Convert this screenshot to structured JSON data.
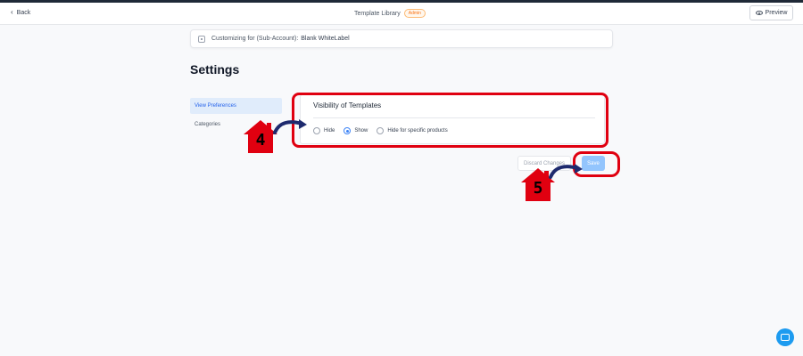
{
  "header": {
    "back_label": "Back",
    "title": "Template Library",
    "badge": "Admin",
    "preview_label": "Preview"
  },
  "customizing": {
    "label": "Customizing for (Sub-Account):",
    "value": "Blank WhiteLabel"
  },
  "page": {
    "title": "Settings"
  },
  "sidebar": {
    "items": [
      {
        "label": "View Preferences",
        "active": true
      },
      {
        "label": "Categories",
        "active": false
      }
    ]
  },
  "visibility": {
    "title": "Visibility of Templates",
    "options": [
      {
        "label": "Hide",
        "selected": false
      },
      {
        "label": "Show",
        "selected": true
      },
      {
        "label": "Hide for specific products",
        "selected": false
      }
    ]
  },
  "actions": {
    "discard_label": "Discard Changes",
    "save_label": "Save"
  },
  "annotations": {
    "step_a": "4",
    "step_b": "5",
    "highlight_color": "#e00010",
    "arrow_color": "#1e2a6e"
  },
  "colors": {
    "accent": "#3b82f6",
    "save_bg": "#93c5fd",
    "help": "#1d9bf0"
  }
}
